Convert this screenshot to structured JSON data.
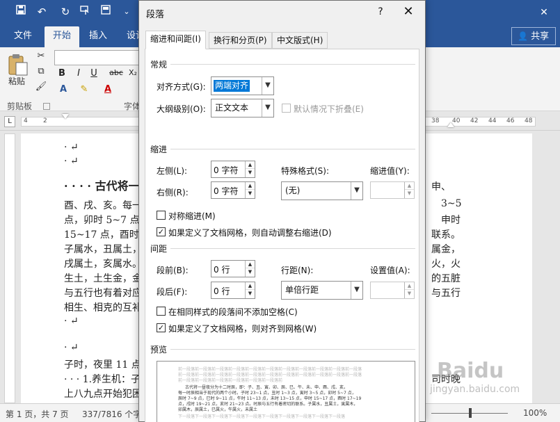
{
  "tabs_ribbon": [
    "文件",
    "开始",
    "插入",
    "设计"
  ],
  "ribbon_active_index": 1,
  "share_label": "共享",
  "ribbon": {
    "paste": "粘贴",
    "clipboard_group": "剪贴板",
    "font_group": "字体",
    "format_buttons": [
      "B",
      "I",
      "U",
      "abc",
      "X₂"
    ]
  },
  "ruler_left": [
    "4",
    "2"
  ],
  "ruler_right": [
    "38",
    "40",
    "42",
    "44",
    "46",
    "48"
  ],
  "document": {
    "lines": [
      "· ↵",
      "· ↵",
      "酉、戌、亥。每一",
      "点，卯时 5~7 点",
      "15~17 点，酉时",
      "子属水，丑属土，",
      "戌属土，亥属水。",
      "生土，土生金，金",
      "与五行也有着对应",
      "相生、相克的互补",
      "· ↵",
      "· ↵",
      "子时，夜里 11 点",
      "· · · 1.养生机：子",
      "上八九点开始犯困"
    ],
    "heading": "· · · · 古代将一",
    "right_lines": [
      "申、",
      "3~5",
      "申时",
      "联系。",
      "属金，",
      "火，火",
      "的五脏",
      "与五行",
      "司时晚"
    ]
  },
  "status": {
    "page": "第 1 页，共 7 页",
    "words": "337/7816 个字",
    "zoom": "100%"
  },
  "dialog": {
    "title": "段落",
    "help": "?",
    "close": "✕",
    "tabs": [
      "缩进和间距(I)",
      "换行和分页(P)",
      "中文版式(H)"
    ],
    "general": {
      "section": "常规",
      "alignment_label": "对齐方式(G):",
      "alignment_value": "两端对齐",
      "outline_label": "大纲级别(O):",
      "outline_value": "正文文本",
      "collapse_label": "默认情况下折叠(E)"
    },
    "indent": {
      "section": "缩进",
      "left_label": "左侧(L):",
      "left_value": "0 字符",
      "right_label": "右侧(R):",
      "right_value": "0 字符",
      "special_label": "特殊格式(S):",
      "special_value": "(无)",
      "by_label": "缩进值(Y):",
      "mirror_label": "对称缩进(M)",
      "auto_adjust_label": "如果定义了文档网格，则自动调整右缩进(D)"
    },
    "spacing": {
      "section": "间距",
      "before_label": "段前(B):",
      "before_value": "0 行",
      "after_label": "段后(F):",
      "after_value": "0 行",
      "line_label": "行距(N):",
      "line_value": "单倍行距",
      "at_label": "设置值(A):",
      "no_space_label": "在相同样式的段落间不添加空格(C)",
      "snap_grid_label": "如果定义了文档网格，则对齐到网格(W)"
    },
    "preview": {
      "section": "预览",
      "gray_line": "前一段落前一段落前一段落前一段落前一段落前一段落前一段落前一段落前一段落前一段落前一段落",
      "sample_1": "古代将一昼夜分为十二时辰，即：子、丑、寅、卯、辰、巳、午、未、申、酉、戌、亥。",
      "sample_2": "每一时辰相当于现代的两个小时。子时 23~1 点，丑时 1~3 点，寅时 3~5 点，卯时 5~7 点，",
      "sample_3": "辰时 7~9 点，巳时 9~11 点，午时 11~13 点，未时 13~15 点，申时 15~17 点，酉时 17~19",
      "sample_4": "点，戌时 19~21 点，亥时 21~23 点。时辰与五行有着密切的联系。子属水，丑属土，寅属木，",
      "sample_5": "卯属木，辰属土，巳属火，午属火，未属土",
      "after_line": "下一段落下一段落下一段落下一段落下一段落下一段落下一段落下一段落下一段落下一段落"
    }
  },
  "watermark": {
    "logo": "Baidu",
    "url": "jingyan.baidu.com"
  }
}
